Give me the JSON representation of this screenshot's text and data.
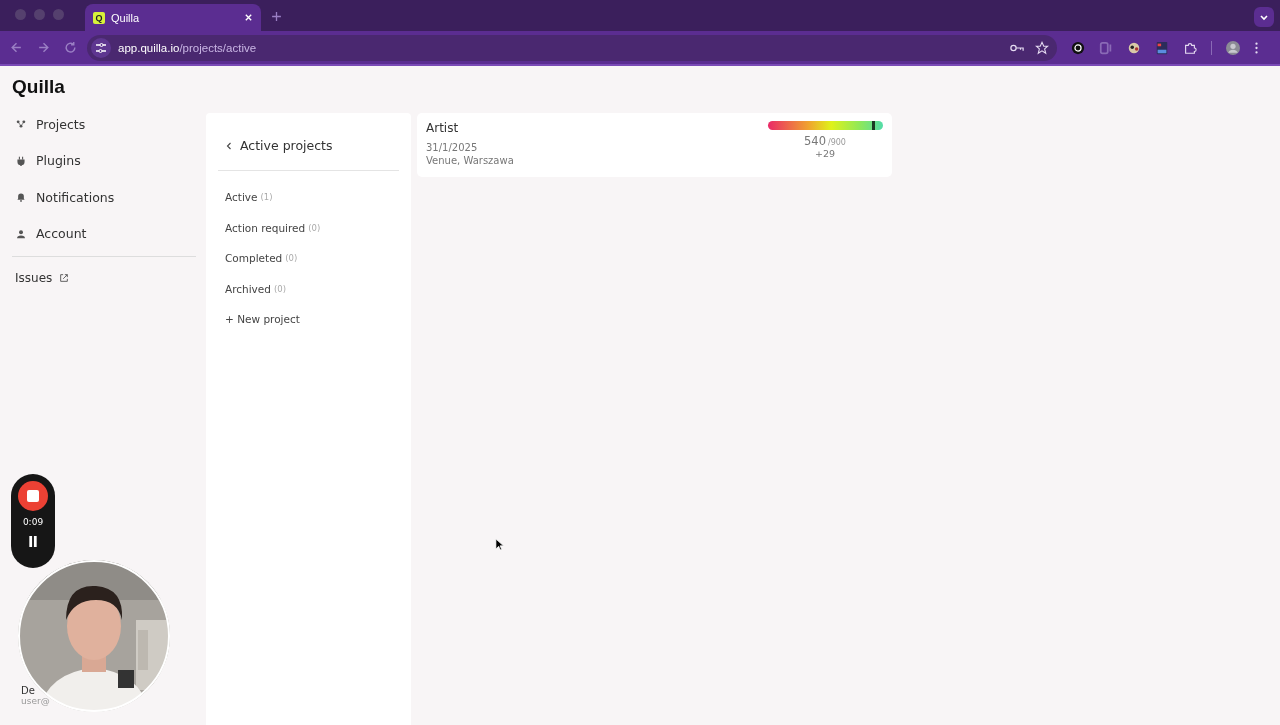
{
  "browser": {
    "tab_title": "Quilla",
    "tab_favicon": "Q",
    "url_host": "app.quilla.io",
    "url_path": "/projects/active"
  },
  "sidebar": {
    "logo": "Quilla",
    "items": [
      {
        "kind": "projects",
        "label": "Projects"
      },
      {
        "kind": "plugins",
        "label": "Plugins"
      },
      {
        "kind": "notifications",
        "label": "Notifications"
      },
      {
        "kind": "account",
        "label": "Account"
      }
    ],
    "external_link": "Issues",
    "user_name": "De",
    "user_email": "user@"
  },
  "panel": {
    "title": "Active projects",
    "filters": [
      {
        "label": "Active",
        "count": "(1)"
      },
      {
        "label": "Action required",
        "count": "(0)"
      },
      {
        "label": "Completed",
        "count": "(0)"
      },
      {
        "label": "Archived",
        "count": "(0)"
      }
    ],
    "new_project": "+ New project"
  },
  "projects": [
    {
      "name": "Artist",
      "date": "31/1/2025",
      "venue": "Venue, Warszawa",
      "score": "540",
      "total": "/900",
      "delta": "+29",
      "level": 0.92
    }
  ],
  "recorder": {
    "time": "0:09"
  }
}
